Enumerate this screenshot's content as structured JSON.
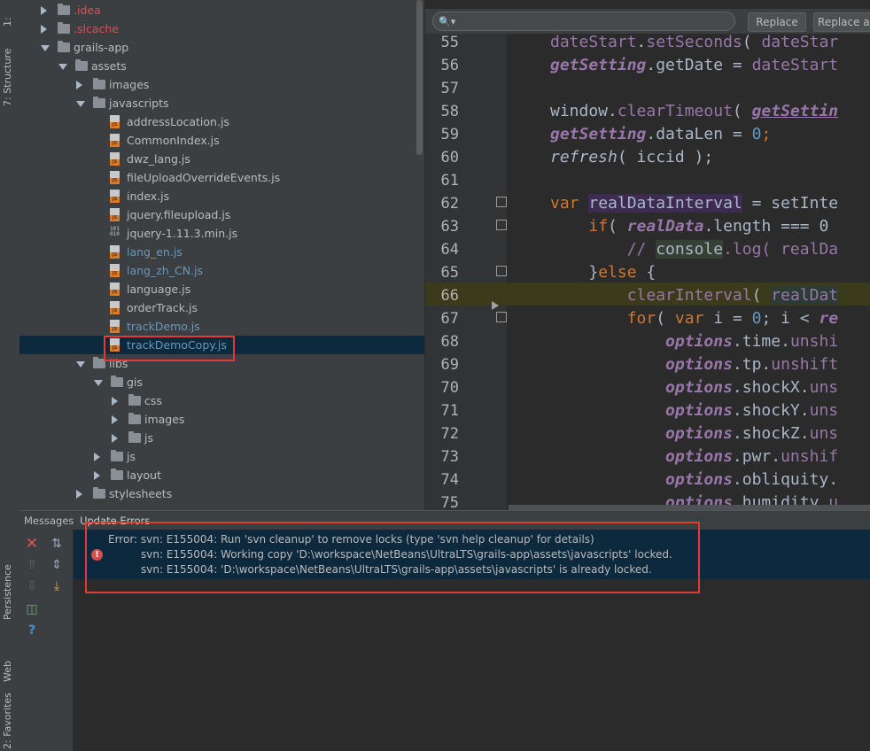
{
  "side_tabs": {
    "project": "1:",
    "structure": "7: Structure",
    "persistence": "Persistence",
    "web": "Web",
    "favorites": "2: Favorites"
  },
  "tree": [
    {
      "label": ".idea",
      "color": "red"
    },
    {
      "label": ".slcache",
      "color": "red"
    },
    {
      "label": "grails-app",
      "color": "normal"
    },
    {
      "label": "assets",
      "color": "normal"
    },
    {
      "label": "images",
      "color": "normal"
    },
    {
      "label": "javascripts",
      "color": "normal"
    },
    {
      "label": "addressLocation.js",
      "color": "normal"
    },
    {
      "label": "CommonIndex.js",
      "color": "normal"
    },
    {
      "label": "dwz_lang.js",
      "color": "normal"
    },
    {
      "label": "fileUploadOverrideEvents.js",
      "color": "normal"
    },
    {
      "label": "index.js",
      "color": "normal"
    },
    {
      "label": "jquery.fileupload.js",
      "color": "normal"
    },
    {
      "label": "jquery-1.11.3.min.js",
      "color": "normal"
    },
    {
      "label": "lang_en.js",
      "color": "blue"
    },
    {
      "label": "lang_zh_CN.js",
      "color": "blue"
    },
    {
      "label": "language.js",
      "color": "normal"
    },
    {
      "label": "orderTrack.js",
      "color": "normal"
    },
    {
      "label": "trackDemo.js",
      "color": "blue"
    },
    {
      "label": "trackDemoCopy.js",
      "color": "blue"
    },
    {
      "label": "libs",
      "color": "normal"
    },
    {
      "label": "gis",
      "color": "normal"
    },
    {
      "label": "css",
      "color": "normal"
    },
    {
      "label": "images",
      "color": "normal"
    },
    {
      "label": "js",
      "color": "normal"
    },
    {
      "label": "js",
      "color": "normal"
    },
    {
      "label": "layout",
      "color": "normal"
    },
    {
      "label": "stylesheets",
      "color": "normal"
    }
  ],
  "search": {
    "replace_label": "Replace",
    "replace_all_label": "Replace al"
  },
  "editor": {
    "line_numbers": [
      "55",
      "56",
      "57",
      "58",
      "59",
      "60",
      "61",
      "62",
      "63",
      "64",
      "65",
      "66",
      "67",
      "68",
      "69",
      "70",
      "71",
      "72",
      "73",
      "74",
      "75"
    ]
  },
  "code": {
    "l55": {
      "a": "dateStart",
      "b": ".",
      "c": "setSeconds",
      "d": "( ",
      "e": "dateStar"
    },
    "l56": {
      "a": "getSetting",
      "b": ".getDate = ",
      "c": "dateStart"
    },
    "l58": {
      "a": "window.",
      "b": "clearTimeout",
      "c": "( ",
      "d": "getSettin"
    },
    "l59": {
      "a": "getSetting",
      "b": ".dataLen = ",
      "c": "0",
      "d": ";"
    },
    "l60": {
      "a": "refresh",
      "b": "( iccid );"
    },
    "l62": {
      "a": "var ",
      "b": "realDataInterval",
      "c": " = setInte"
    },
    "l63": {
      "a": "if",
      "b": "( ",
      "c": "realData",
      "d": ".length === 0"
    },
    "l64": {
      "a": "// ",
      "b": "console",
      "c": ".log( realDa"
    },
    "l65": {
      "a": "}",
      "b": "else",
      "c": " {"
    },
    "l66": {
      "a": "clearInterval",
      "b": "( ",
      "c": "realDat"
    },
    "l67": {
      "a": "for",
      "b": "( ",
      "c": "var",
      "d": " i = ",
      "e": "0",
      "f": "; i < ",
      "g": "re"
    },
    "l68": {
      "a": "options",
      "b": ".time.",
      "c": "unshi"
    },
    "l69": {
      "a": "options",
      "b": ".tp.",
      "c": "unshift"
    },
    "l70": {
      "a": "options",
      "b": ".shockX.",
      "c": "uns"
    },
    "l71": {
      "a": "options",
      "b": ".shockY.",
      "c": "uns"
    },
    "l72": {
      "a": "options",
      "b": ".shockZ.",
      "c": "uns"
    },
    "l73": {
      "a": "options",
      "b": ".pwr.",
      "c": "unshif"
    },
    "l74": {
      "a": "options",
      "b": ".obliquity.",
      "c": ""
    },
    "l75": {
      "a": "options",
      "b": ".humidity.",
      "c": "u"
    }
  },
  "messages": {
    "tab_title": "Messages",
    "tab_name": "Update Errors",
    "lines": [
      "Error: svn: E155004: Run 'svn cleanup' to remove locks (type 'svn help cleanup' for details)",
      "svn: E155004: Working copy 'D:\\workspace\\NetBeans\\UltraLTS\\grails-app\\assets\\javascripts' locked.",
      "svn: E155004: 'D:\\workspace\\NetBeans\\UltraLTS\\grails-app\\assets\\javascripts' is already locked."
    ]
  },
  "colors": {
    "accent_red": "#e53935",
    "selection": "#0d293e",
    "keyword": "#cc7832",
    "field": "#9876aa",
    "number": "#6897bb"
  }
}
